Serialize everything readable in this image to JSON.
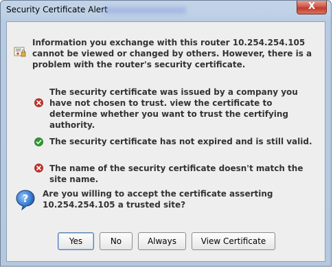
{
  "window": {
    "title": "Security Certificate Alert",
    "close_symbol": "X"
  },
  "header": {
    "icon": "certificate-lock-icon",
    "text": "Information you exchange with this router 10.254.254.105 cannot be viewed or changed by others. However, there is a problem with the router's security certificate."
  },
  "checks": [
    {
      "status": "error",
      "icon": "error-icon",
      "text": "The security certificate was issued by a company you have not chosen to trust. view the certificate to determine whether you want to trust the certifying authority."
    },
    {
      "status": "ok",
      "icon": "check-icon",
      "text": "The security certificate has not expired and is still valid."
    },
    {
      "status": "error",
      "icon": "error-icon",
      "text": "The name of the security certificate doesn't match the site name."
    }
  ],
  "question": {
    "icon": "question-icon",
    "text": "Are you willing to accept the certificate asserting 10.254.254.105 a trusted site?"
  },
  "buttons": {
    "yes": "Yes",
    "no": "No",
    "always": "Always",
    "view_certificate": "View Certificate"
  },
  "colors": {
    "error": "#c8312b",
    "ok": "#2e9b2e",
    "question": "#2f6fc4"
  }
}
